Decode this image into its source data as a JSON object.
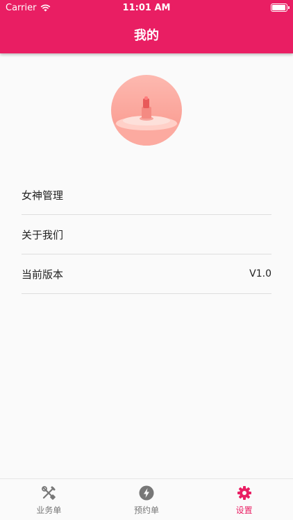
{
  "status_bar": {
    "carrier": "Carrier",
    "time": "11:01 AM",
    "battery_level": 1.0
  },
  "header": {
    "title": "我的"
  },
  "menu": {
    "items": [
      {
        "label": "女神管理",
        "value": ""
      },
      {
        "label": "关于我们",
        "value": ""
      },
      {
        "label": "当前版本",
        "value": "V1.0"
      }
    ]
  },
  "tabbar": {
    "tabs": [
      {
        "label": "业务单",
        "icon": "tools-icon",
        "active": false
      },
      {
        "label": "预约单",
        "icon": "lightning-icon",
        "active": false
      },
      {
        "label": "设置",
        "icon": "gear-icon",
        "active": true
      }
    ]
  },
  "colors": {
    "accent": "#e91e63",
    "inactive": "#777777"
  }
}
